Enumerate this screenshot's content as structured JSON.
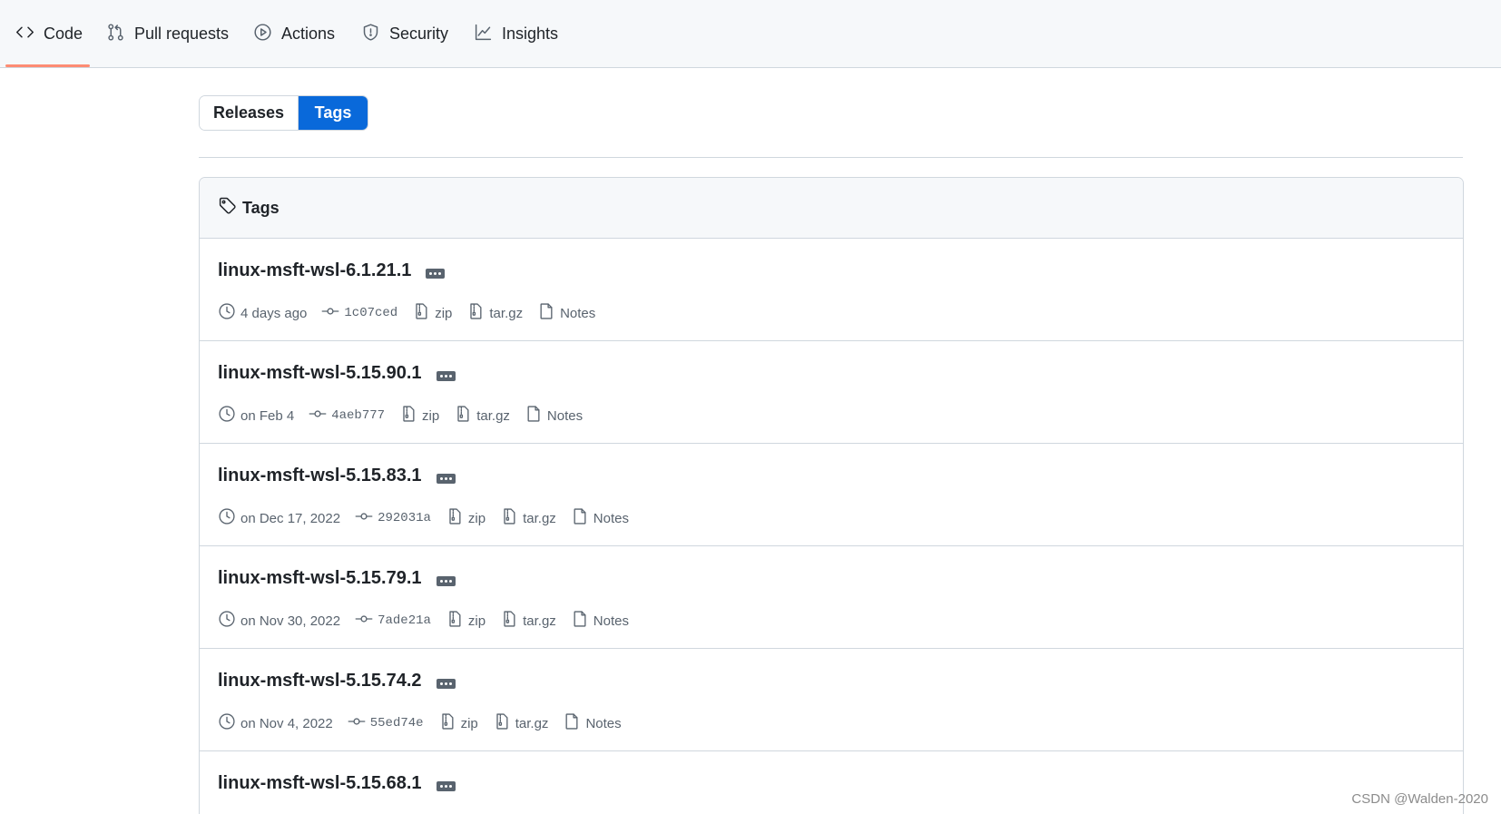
{
  "nav": {
    "tabs": [
      {
        "label": "Code",
        "icon": "code-icon",
        "active": true
      },
      {
        "label": "Pull requests",
        "icon": "git-pull-request-icon"
      },
      {
        "label": "Actions",
        "icon": "play-icon"
      },
      {
        "label": "Security",
        "icon": "shield-icon"
      },
      {
        "label": "Insights",
        "icon": "graph-icon"
      }
    ],
    "active_underline_color": "#fd8c73"
  },
  "segmented": {
    "releases_label": "Releases",
    "tags_label": "Tags",
    "selected": "Tags",
    "selected_color": "#0969da"
  },
  "box": {
    "header_label": "Tags",
    "header_icon": "tag-icon"
  },
  "tags": [
    {
      "name": "linux-msft-wsl-6.1.21.1",
      "date": "4 days ago",
      "sha": "1c07ced",
      "zip": "zip",
      "targz": "tar.gz",
      "notes": "Notes"
    },
    {
      "name": "linux-msft-wsl-5.15.90.1",
      "date": "on Feb 4",
      "sha": "4aeb777",
      "zip": "zip",
      "targz": "tar.gz",
      "notes": "Notes"
    },
    {
      "name": "linux-msft-wsl-5.15.83.1",
      "date": "on Dec 17, 2022",
      "sha": "292031a",
      "zip": "zip",
      "targz": "tar.gz",
      "notes": "Notes"
    },
    {
      "name": "linux-msft-wsl-5.15.79.1",
      "date": "on Nov 30, 2022",
      "sha": "7ade21a",
      "zip": "zip",
      "targz": "tar.gz",
      "notes": "Notes"
    },
    {
      "name": "linux-msft-wsl-5.15.74.2",
      "date": "on Nov 4, 2022",
      "sha": "55ed74e",
      "zip": "zip",
      "targz": "tar.gz",
      "notes": "Notes"
    },
    {
      "name": "linux-msft-wsl-5.15.68.1",
      "date": "",
      "sha": "",
      "zip": "",
      "targz": "",
      "notes": ""
    }
  ],
  "watermark": "CSDN @Walden-2020"
}
